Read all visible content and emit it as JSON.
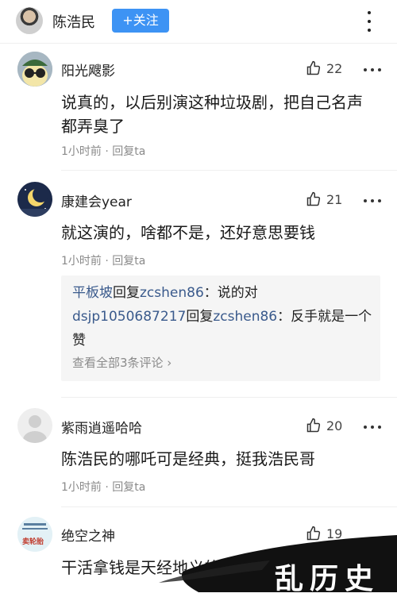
{
  "header": {
    "username": "陈浩民",
    "follow_label": "+关注"
  },
  "comments": [
    {
      "name": "阳光飕影",
      "likes": "22",
      "text": "说真的，以后别演这种垃圾剧，把自己名声都弄臭了",
      "time": "1小时前",
      "reply": "回复ta",
      "avatar_icon": "glasses-avatar-icon"
    },
    {
      "name": "康建会year",
      "likes": "21",
      "text": "就这演的，啥都不是，还好意思要钱",
      "time": "1小时前",
      "reply": "回复ta",
      "avatar_icon": "moon-avatar-icon",
      "replies": [
        {
          "user": "平板坡",
          "verb": "回复",
          "target": "zcshen86",
          "content": "：说的对"
        },
        {
          "user": "dsjp1050687217",
          "verb": "回复",
          "target": "zcshen86",
          "content": "：反手就是一个赞"
        }
      ],
      "view_all": "查看全部3条评论 ›"
    },
    {
      "name": "紫雨逍遥哈哈",
      "likes": "20",
      "text": "陈浩民的哪吒可是经典，挺我浩民哥",
      "time": "1小时前",
      "reply": "回复ta",
      "avatar_icon": "default-avatar-icon"
    },
    {
      "name": "绝空之神",
      "likes": "19",
      "text": "干活拿钱是天经地义的",
      "avatar_icon": "poster-avatar-icon",
      "avatar_text": "卖轮胎"
    }
  ],
  "watermark": "乱历史",
  "colors": {
    "accent": "#3d93f4",
    "reply_user": "#3a5a8c"
  }
}
